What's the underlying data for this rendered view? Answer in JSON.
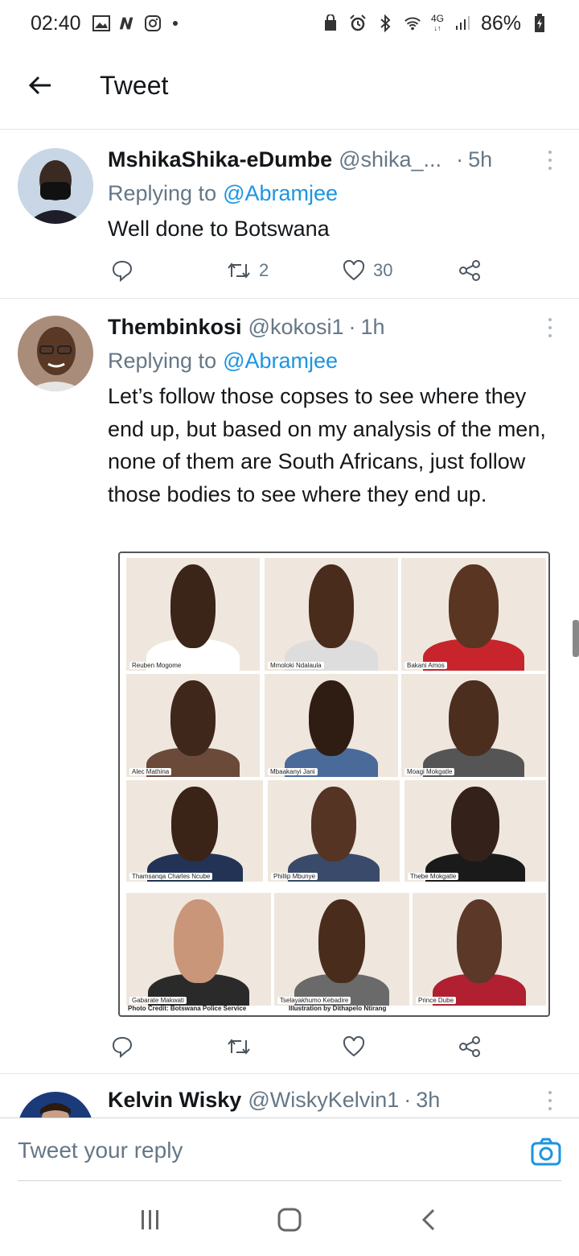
{
  "status_bar": {
    "time": "02:40",
    "battery": "86%",
    "network": "4G",
    "left_icons": [
      "gallery-icon",
      "n-app-icon",
      "instagram-icon"
    ],
    "right_icons": [
      "bag-icon",
      "alarm-icon",
      "bluetooth-icon",
      "wifi-icon",
      "signal-icon",
      "battery-icon"
    ]
  },
  "header": {
    "title": "Tweet"
  },
  "tweets": [
    {
      "name": "MshikaShika-eDumbe",
      "handle": "@shika_...",
      "sep": "·",
      "time": "5h",
      "replying_prefix": "Replying to",
      "replying_to": "@Abramjee",
      "text": "Well done to Botswana",
      "retweets": "2",
      "likes": "30"
    },
    {
      "name": "Thembinkosi",
      "handle": "@kokosi1",
      "sep": "·",
      "time": "1h",
      "replying_prefix": "Replying to",
      "replying_to": "@Abramjee",
      "text": "Let’s follow those copses to see where they end up, but based on my analysis of the men, none of them are South Africans, just follow those bodies to see where they end up.",
      "retweets": "",
      "likes": "",
      "photo": {
        "captions": [
          "Reuben Mogome",
          "Mmoloki Ndalaula",
          "Bakani Amos",
          "Alec Mathina",
          "Mbaakanyi Jani",
          "Moagi Mokgatle",
          "Thamsanqa Charles Ncube",
          "Phillip Mbunye",
          "Thebe Mokgatle",
          "Gabarate Makwati",
          "Tselayakhumo Kebadire",
          "Prince Dube"
        ],
        "credit_left": "Photo Credit: Botswana Police Service",
        "credit_right": "Illustration by Dithapelo Ntirang"
      }
    },
    {
      "name": "Kelvin Wisky",
      "handle": "@WiskyKelvin1",
      "sep": "·",
      "time": "3h"
    }
  ],
  "reply_bar": {
    "placeholder": "Tweet your reply"
  },
  "colors": {
    "accent": "#1b95e0",
    "secondary_text": "#657786",
    "primary_text": "#14171a",
    "divider": "#e1e6ea"
  }
}
